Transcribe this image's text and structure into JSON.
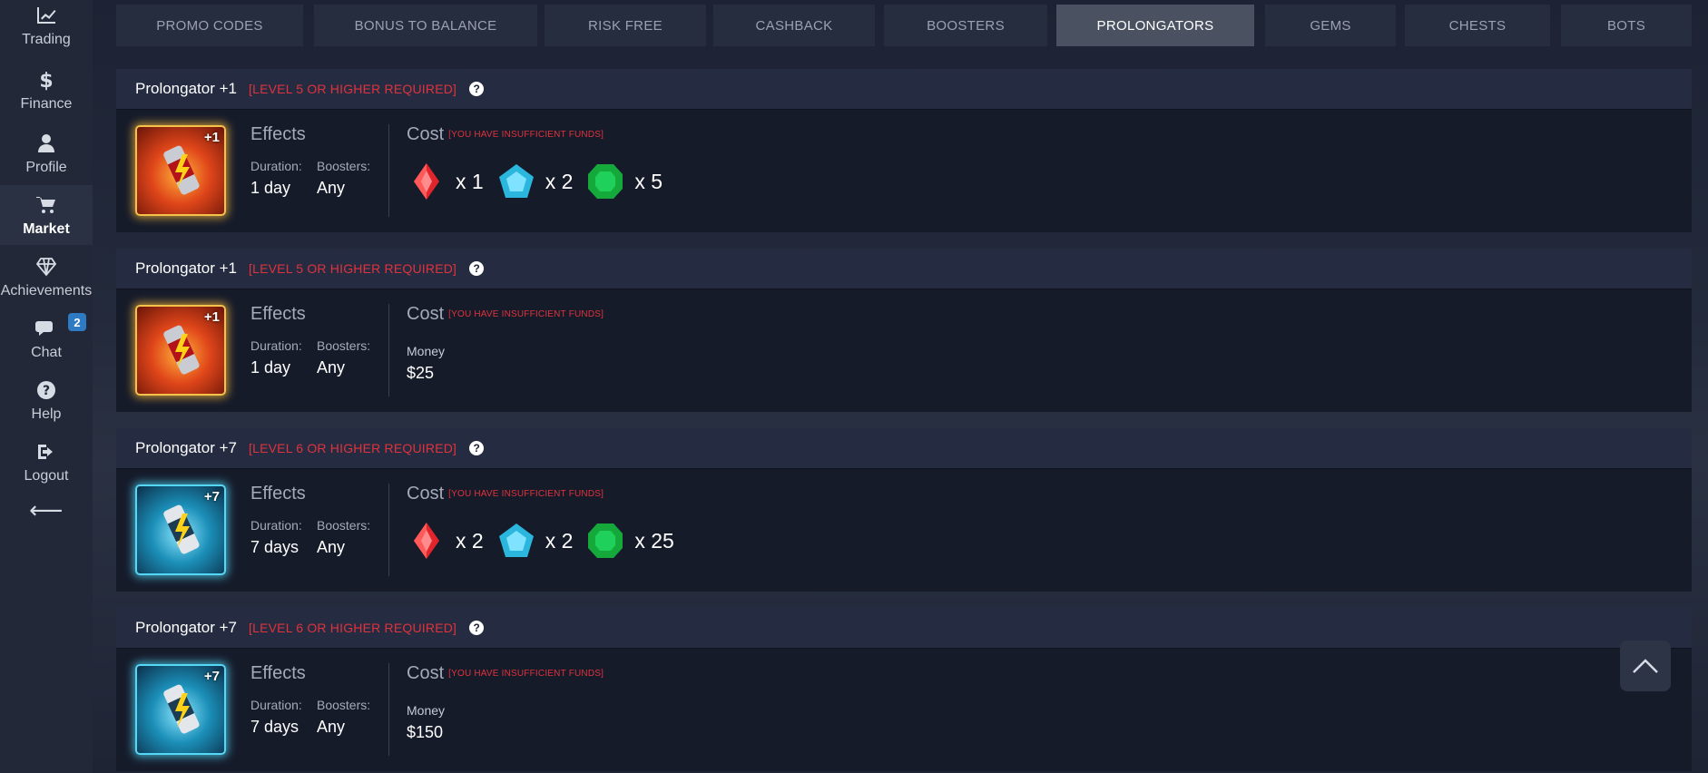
{
  "sidebar": {
    "items": [
      {
        "label": "Trading",
        "icon": "chart-line-icon"
      },
      {
        "label": "Finance",
        "icon": "dollar-icon"
      },
      {
        "label": "Profile",
        "icon": "user-icon"
      },
      {
        "label": "Market",
        "icon": "cart-icon",
        "active": true
      },
      {
        "label": "Achievements",
        "icon": "diamond-icon"
      },
      {
        "label": "Chat",
        "icon": "chat-icon",
        "badge": "2"
      },
      {
        "label": "Help",
        "icon": "question-icon"
      },
      {
        "label": "Logout",
        "icon": "logout-icon"
      }
    ],
    "collapse_icon": "arrow-left-icon"
  },
  "tabs": [
    {
      "label": "PROMO CODES"
    },
    {
      "label": "BONUS TO BALANCE"
    },
    {
      "label": "RISK FREE"
    },
    {
      "label": "CASHBACK"
    },
    {
      "label": "BOOSTERS"
    },
    {
      "label": "PROLONGATORS",
      "active": true
    },
    {
      "label": "GEMS"
    },
    {
      "label": "CHESTS"
    },
    {
      "label": "BOTS"
    }
  ],
  "labels": {
    "effects": "Effects",
    "duration": "Duration:",
    "boosters": "Boosters:",
    "cost": "Cost",
    "insufficient": "[YOU HAVE INSUFFICIENT FUNDS]",
    "money": "Money"
  },
  "cards": [
    {
      "title": "Prolongator +1",
      "requirement": "[LEVEL 5 OR HIGHER REQUIRED]",
      "badge_text": "+1",
      "theme": "fire",
      "duration": "1 day",
      "boosters": "Any",
      "cost_type": "gems",
      "gems": {
        "red": "x 1",
        "blue": "x 2",
        "green": "x 5"
      }
    },
    {
      "title": "Prolongator +1",
      "requirement": "[LEVEL 5 OR HIGHER REQUIRED]",
      "badge_text": "+1",
      "theme": "fire",
      "duration": "1 day",
      "boosters": "Any",
      "cost_type": "money",
      "money": "$25"
    },
    {
      "title": "Prolongator +7",
      "requirement": "[LEVEL 6 OR HIGHER REQUIRED]",
      "badge_text": "+7",
      "theme": "ice",
      "duration": "7 days",
      "boosters": "Any",
      "cost_type": "gems",
      "gems": {
        "red": "x 2",
        "blue": "x 2",
        "green": "x 25"
      }
    },
    {
      "title": "Prolongator +7",
      "requirement": "[LEVEL 6 OR HIGHER REQUIRED]",
      "badge_text": "+7",
      "theme": "ice",
      "duration": "7 days",
      "boosters": "Any",
      "cost_type": "money",
      "money": "$150"
    }
  ],
  "colors": {
    "accent_red": "#e0323c",
    "card_header": "#252c42",
    "card_body": "#161b2a",
    "tab_active": "#4a5161"
  },
  "scroll_top_icon": "chevron-up-icon"
}
